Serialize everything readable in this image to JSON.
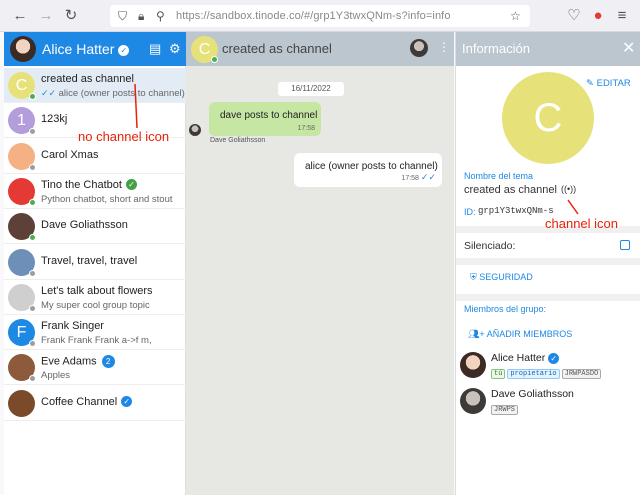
{
  "browser": {
    "url": "https://sandbox.tinode.co/#/grp1Y3twxQNm-s?info=info"
  },
  "sidebar": {
    "user_name": "Alice Hatter",
    "contacts": [
      {
        "title": "created as channel",
        "subtitle": "alice (owner posts to channel)",
        "avatar_letter": "C",
        "avatar_color": "#e6e279",
        "status": "#4caf50"
      },
      {
        "title": "123kj",
        "subtitle": "",
        "avatar_letter": "1",
        "avatar_color": "#b39ddb",
        "status": "#9e9e9e"
      },
      {
        "title": "Carol Xmas",
        "subtitle": "",
        "avatar_letter": "",
        "avatar_color": "#f4b183",
        "status": "#9e9e9e"
      },
      {
        "title": "Tino the Chatbot",
        "subtitle": "Python chatbot, short and stout",
        "avatar_letter": "",
        "avatar_color": "#e53935",
        "status": "#4caf50"
      },
      {
        "title": "Dave Goliathsson",
        "subtitle": "",
        "avatar_letter": "",
        "avatar_color": "#5d4037",
        "status": "#4caf50"
      },
      {
        "title": "Travel, travel, travel",
        "subtitle": "",
        "avatar_letter": "",
        "avatar_color": "#6d8fb8",
        "status": "#9e9e9e"
      },
      {
        "title": "Let's talk about flowers",
        "subtitle": "My super cool group topic",
        "avatar_letter": "",
        "avatar_color": "#cfcfcf",
        "status": "#9e9e9e"
      },
      {
        "title": "Frank Singer",
        "subtitle": "Frank Frank Frank a->f m,",
        "avatar_letter": "F",
        "avatar_color": "#1e88e5",
        "status": "#9e9e9e"
      },
      {
        "title": "Eve Adams",
        "subtitle": "Apples",
        "avatar_letter": "",
        "avatar_color": "#8d5a3b",
        "status": "#9e9e9e",
        "badge": "2"
      },
      {
        "title": "Coffee Channel",
        "subtitle": "",
        "avatar_letter": "",
        "avatar_color": "#7b4a2a",
        "status": "",
        "verified": true
      }
    ]
  },
  "chat": {
    "title": "created as channel",
    "avatar_letter": "C",
    "date": "16/11/2022",
    "messages": [
      {
        "text": "dave posts to channel",
        "time": "17:58",
        "author": "Dave Goliathsson"
      },
      {
        "text": "alice (owner posts to channel)",
        "time": "17:58"
      }
    ]
  },
  "info": {
    "title": "Información",
    "edit_label": "EDITAR",
    "avatar_letter": "C",
    "topic_label": "Nombre del tema",
    "topic_name": "created as channel",
    "id_label": "ID:",
    "id_value": "grp1Y3twxQNm-s",
    "muted_label": "Silenciado:",
    "security_label": "SEGURIDAD",
    "members_label": "Miembros del grupo:",
    "add_members_label": "AÑADIR MIEMBROS",
    "members": [
      {
        "name": "Alice Hatter",
        "tags": [
          "tú",
          "propietario",
          "JRWPASDO"
        ]
      },
      {
        "name": "Dave Goliathsson",
        "tags": [
          "JRWPS"
        ]
      }
    ]
  },
  "annotations": {
    "no_channel_icon": "no channel icon",
    "channel_icon": "channel icon"
  },
  "colors": {
    "accent": "#1e88e5",
    "annotation": "#e8220a"
  }
}
